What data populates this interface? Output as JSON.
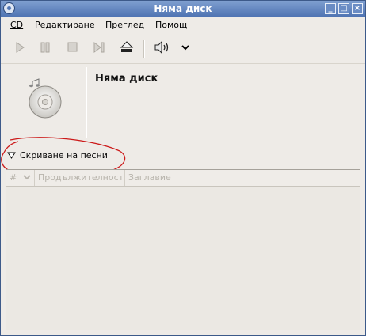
{
  "window": {
    "title": "Няма диск",
    "buttons": {
      "minimize": "_",
      "maximize": "□",
      "close": "×"
    }
  },
  "menubar": {
    "items": [
      {
        "label": "CD",
        "mnemonic": "C"
      },
      {
        "label": "Редактиране"
      },
      {
        "label": "Преглед"
      },
      {
        "label": "Помощ"
      }
    ]
  },
  "toolbar": {
    "icons": [
      "play-icon",
      "pause-icon",
      "stop-icon",
      "next-track-icon",
      "eject-icon",
      "volume-icon",
      "volume-menu-icon"
    ]
  },
  "disc": {
    "title": "Няма диск",
    "cover_icon": "music-cd-icon"
  },
  "tracks": {
    "toggle_label": "Скриване на песни",
    "columns": [
      "#",
      "Продължителност",
      "Заглавие"
    ]
  },
  "colors": {
    "titlebar_top": "#7f9fd0",
    "titlebar_bottom": "#4f74b3",
    "window_bg": "#eeebe7",
    "annotation_red": "#cc1a1a"
  }
}
